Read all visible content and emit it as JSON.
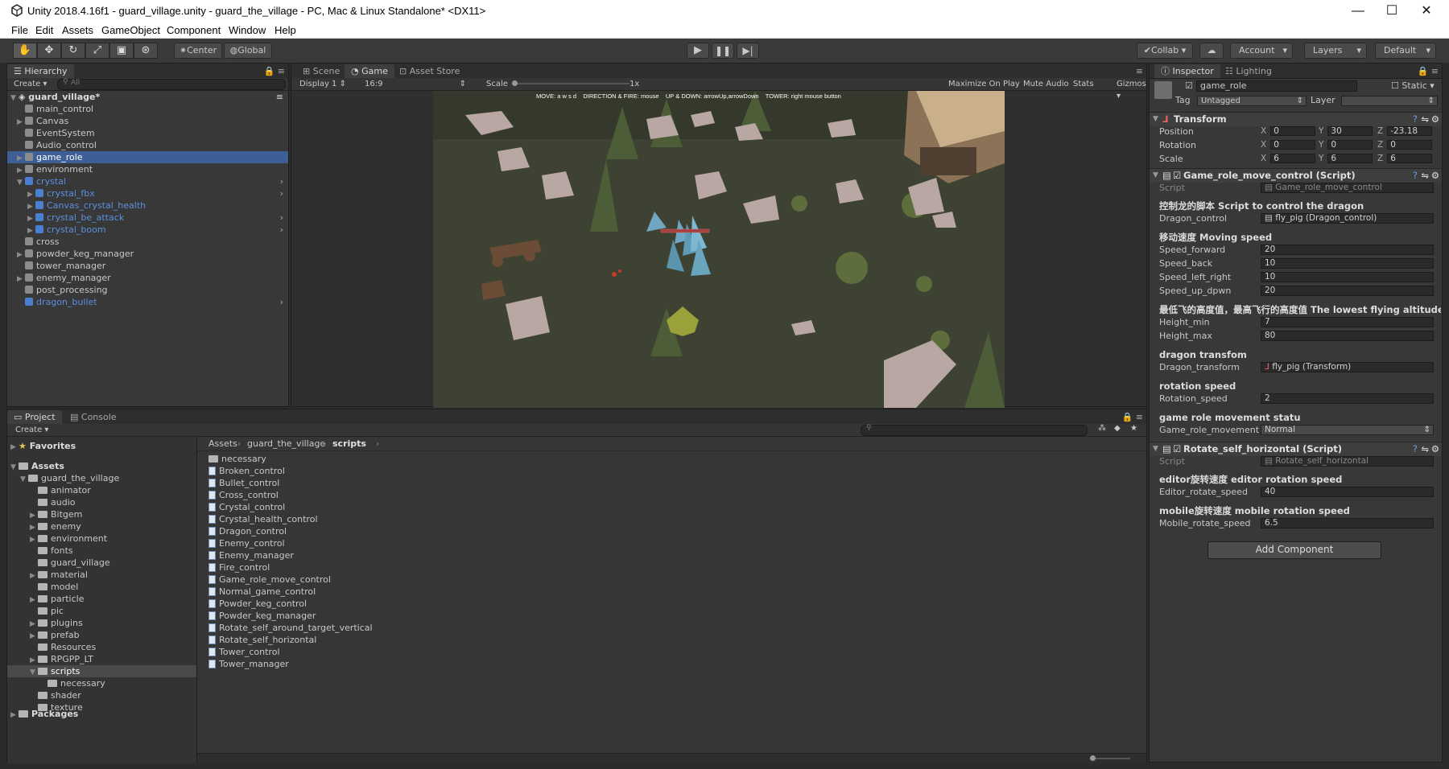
{
  "window": {
    "title": "Unity 2018.4.16f1 - guard_village.unity - guard_the_village - PC, Mac & Linux Standalone* <DX11>",
    "minimize": "—",
    "maximize": "☐",
    "close": "✕"
  },
  "menu": [
    "File",
    "Edit",
    "Assets",
    "GameObject",
    "Component",
    "Window",
    "Help"
  ],
  "toolbar": {
    "pivot": "Center",
    "space": "Global",
    "collab": "Collab ▾",
    "account": "Account",
    "layers": "Layers",
    "layout": "Default"
  },
  "hierarchy": {
    "tab": "Hierarchy",
    "create": "Create ▾",
    "search_placeholder": "All",
    "scene": "guard_village*",
    "items": [
      {
        "label": "main_control",
        "depth": 1,
        "expandable": false,
        "prefab": false,
        "selected": false
      },
      {
        "label": "Canvas",
        "depth": 1,
        "expandable": true,
        "prefab": false,
        "selected": false
      },
      {
        "label": "EventSystem",
        "depth": 1,
        "expandable": false,
        "prefab": false,
        "selected": false
      },
      {
        "label": "Audio_control",
        "depth": 1,
        "expandable": false,
        "prefab": false,
        "selected": false
      },
      {
        "label": "game_role",
        "depth": 1,
        "expandable": true,
        "prefab": false,
        "selected": true
      },
      {
        "label": "environment",
        "depth": 1,
        "expandable": true,
        "prefab": false,
        "selected": false
      },
      {
        "label": "crystal",
        "depth": 1,
        "expandable": true,
        "expanded": true,
        "prefab": true,
        "selected": false
      },
      {
        "label": "crystal_fbx",
        "depth": 2,
        "expandable": true,
        "prefab": true,
        "selected": false
      },
      {
        "label": "Canvas_crystal_health",
        "depth": 2,
        "expandable": true,
        "prefab": true,
        "selected": false
      },
      {
        "label": "crystal_be_attack",
        "depth": 2,
        "expandable": true,
        "prefab": true,
        "selected": false
      },
      {
        "label": "crystal_boom",
        "depth": 2,
        "expandable": true,
        "prefab": true,
        "selected": false
      },
      {
        "label": "cross",
        "depth": 1,
        "expandable": false,
        "prefab": false,
        "selected": false
      },
      {
        "label": "powder_keg_manager",
        "depth": 1,
        "expandable": true,
        "prefab": false,
        "selected": false
      },
      {
        "label": "tower_manager",
        "depth": 1,
        "expandable": false,
        "prefab": false,
        "selected": false
      },
      {
        "label": "enemy_manager",
        "depth": 1,
        "expandable": true,
        "prefab": false,
        "selected": false
      },
      {
        "label": "post_processing",
        "depth": 1,
        "expandable": false,
        "prefab": false,
        "selected": false
      },
      {
        "label": "dragon_bullet",
        "depth": 1,
        "expandable": false,
        "prefab": true,
        "selected": false
      }
    ]
  },
  "game_view": {
    "tabs": [
      "Scene",
      "Game",
      "Asset Store"
    ],
    "display": "Display 1",
    "aspect": "16:9",
    "scale_label": "Scale",
    "scale_value": "1x",
    "options": [
      "Maximize On Play",
      "Mute Audio",
      "Stats",
      "Gizmos"
    ],
    "hud_text": "MOVE: a w s d    DIRECTION & FIRE: mouse    UP & DOWN: arrowUp,arrowDown    TOWER: right mouse button"
  },
  "project": {
    "tabs": [
      "Project",
      "Console"
    ],
    "create": "Create ▾",
    "favorites": "Favorites",
    "assets": "Assets",
    "packages": "Packages",
    "tree": [
      {
        "label": "guard_the_village",
        "depth": 1,
        "expandable": true,
        "expanded": true,
        "selected": false
      },
      {
        "label": "animator",
        "depth": 2,
        "expandable": false,
        "selected": false
      },
      {
        "label": "audio",
        "depth": 2,
        "expandable": false,
        "selected": false
      },
      {
        "label": "Bitgem",
        "depth": 2,
        "expandable": true,
        "selected": false
      },
      {
        "label": "enemy",
        "depth": 2,
        "expandable": true,
        "selected": false
      },
      {
        "label": "environment",
        "depth": 2,
        "expandable": true,
        "selected": false
      },
      {
        "label": "fonts",
        "depth": 2,
        "expandable": false,
        "selected": false
      },
      {
        "label": "guard_village",
        "depth": 2,
        "expandable": false,
        "selected": false
      },
      {
        "label": "material",
        "depth": 2,
        "expandable": true,
        "selected": false
      },
      {
        "label": "model",
        "depth": 2,
        "expandable": false,
        "selected": false
      },
      {
        "label": "particle",
        "depth": 2,
        "expandable": true,
        "selected": false
      },
      {
        "label": "pic",
        "depth": 2,
        "expandable": false,
        "selected": false
      },
      {
        "label": "plugins",
        "depth": 2,
        "expandable": true,
        "selected": false
      },
      {
        "label": "prefab",
        "depth": 2,
        "expandable": true,
        "selected": false
      },
      {
        "label": "Resources",
        "depth": 2,
        "expandable": false,
        "selected": false
      },
      {
        "label": "RPGPP_LT",
        "depth": 2,
        "expandable": true,
        "selected": false
      },
      {
        "label": "scripts",
        "depth": 2,
        "expandable": true,
        "expanded": true,
        "selected": true
      },
      {
        "label": "necessary",
        "depth": 3,
        "expandable": false,
        "selected": false
      },
      {
        "label": "shader",
        "depth": 2,
        "expandable": false,
        "selected": false
      },
      {
        "label": "texture",
        "depth": 2,
        "expandable": false,
        "selected": false
      }
    ],
    "breadcrumb": [
      "Assets",
      "guard_the_village",
      "scripts"
    ],
    "files": [
      {
        "label": "necessary",
        "folder": true
      },
      {
        "label": "Broken_control",
        "folder": false
      },
      {
        "label": "Bullet_control",
        "folder": false
      },
      {
        "label": "Cross_control",
        "folder": false
      },
      {
        "label": "Crystal_control",
        "folder": false
      },
      {
        "label": "Crystal_health_control",
        "folder": false
      },
      {
        "label": "Dragon_control",
        "folder": false
      },
      {
        "label": "Enemy_control",
        "folder": false
      },
      {
        "label": "Enemy_manager",
        "folder": false
      },
      {
        "label": "Fire_control",
        "folder": false
      },
      {
        "label": "Game_role_move_control",
        "folder": false
      },
      {
        "label": "Normal_game_control",
        "folder": false
      },
      {
        "label": "Powder_keg_control",
        "folder": false
      },
      {
        "label": "Powder_keg_manager",
        "folder": false
      },
      {
        "label": "Rotate_self_around_target_vertical",
        "folder": false
      },
      {
        "label": "Rotate_self_horizontal",
        "folder": false
      },
      {
        "label": "Tower_control",
        "folder": false
      },
      {
        "label": "Tower_manager",
        "folder": false
      }
    ]
  },
  "inspector": {
    "tabs": [
      "Inspector",
      "Lighting"
    ],
    "object_name": "game_role",
    "static_label": "Static",
    "tag_label": "Tag",
    "tag_value": "Untagged",
    "layer_label": "Layer",
    "layer_value": "",
    "transform": {
      "title": "Transform",
      "position": {
        "label": "Position",
        "x": "0",
        "y": "30",
        "z": "-23.18"
      },
      "rotation": {
        "label": "Rotation",
        "x": "0",
        "y": "0",
        "z": "0"
      },
      "scale": {
        "label": "Scale",
        "x": "6",
        "y": "6",
        "z": "6"
      }
    },
    "move_script": {
      "title": "Game_role_move_control (Script)",
      "script_label": "Script",
      "script_value": "Game_role_move_control",
      "header1": "控制龙的脚本 Script to control the dragon",
      "dragon_control_label": "Dragon_control",
      "dragon_control_value": "fly_pig (Dragon_control)",
      "header2": "移动速度 Moving speed",
      "speed_forward_label": "Speed_forward",
      "speed_forward": "20",
      "speed_back_label": "Speed_back",
      "speed_back": "10",
      "speed_left_right_label": "Speed_left_right",
      "speed_left_right": "10",
      "speed_up_down_label": "Speed_up_dpwn",
      "speed_up_down": "20",
      "header3": "最低飞的高度值，最高飞行的高度值 The lowest flying altitude val",
      "height_min_label": "Height_min",
      "height_min": "7",
      "height_max_label": "Height_max",
      "height_max": "80",
      "header4": "dragon transfom",
      "dragon_transform_label": "Dragon_transform",
      "dragon_transform_value": "fly_pig (Transform)",
      "header5": "rotation speed",
      "rotation_speed_label": "Rotation_speed",
      "rotation_speed": "2",
      "header6": "game role movement statu",
      "movement_label": "Game_role_movement",
      "movement_value": "Normal"
    },
    "rotate_script": {
      "title": "Rotate_self_horizontal (Script)",
      "script_label": "Script",
      "script_value": "Rotate_self_horizontal",
      "header1": "editor旋转速度 editor rotation speed",
      "editor_speed_label": "Editor_rotate_speed",
      "editor_speed": "40",
      "header2": "mobile旋转速度 mobile rotation speed",
      "mobile_speed_label": "Mobile_rotate_speed",
      "mobile_speed": "6.5"
    },
    "add_component": "Add Component"
  },
  "colors": {
    "selection": "#3e5f96",
    "prefab_text": "#5b8fe0",
    "panel_bg": "#383838",
    "ground": "#3d4232"
  }
}
